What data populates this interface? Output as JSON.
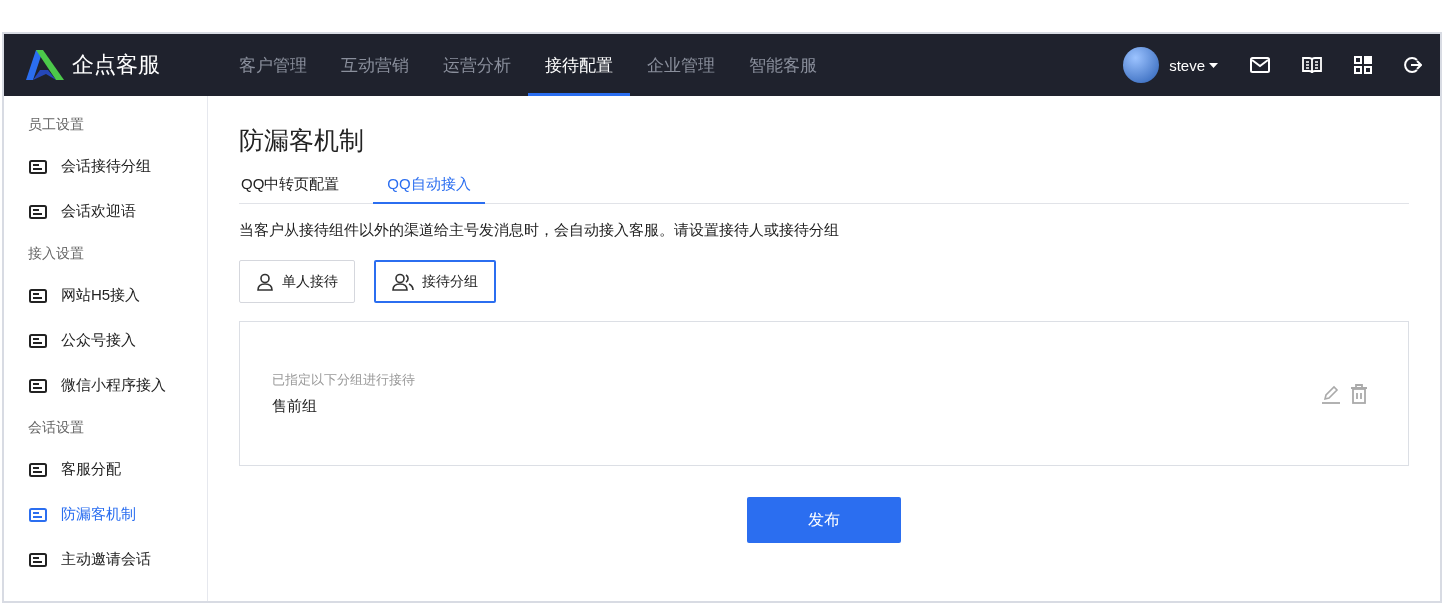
{
  "brand": {
    "name": "企点客服"
  },
  "nav": {
    "items": [
      {
        "label": "客户管理",
        "selected": false
      },
      {
        "label": "互动营销",
        "selected": false
      },
      {
        "label": "运营分析",
        "selected": false
      },
      {
        "label": "接待配置",
        "selected": true
      },
      {
        "label": "企业管理",
        "selected": false
      },
      {
        "label": "智能客服",
        "selected": false
      }
    ],
    "user": {
      "name": "steve"
    }
  },
  "sidebar": {
    "sections": [
      {
        "title": "员工设置",
        "items": [
          {
            "label": "会话接待分组",
            "selected": false
          },
          {
            "label": "会话欢迎语",
            "selected": false
          }
        ]
      },
      {
        "title": "接入设置",
        "items": [
          {
            "label": "网站H5接入",
            "selected": false
          },
          {
            "label": "公众号接入",
            "selected": false
          },
          {
            "label": "微信小程序接入",
            "selected": false
          }
        ]
      },
      {
        "title": "会话设置",
        "items": [
          {
            "label": "客服分配",
            "selected": false
          },
          {
            "label": "防漏客机制",
            "selected": true
          },
          {
            "label": "主动邀请会话",
            "selected": false
          }
        ]
      }
    ]
  },
  "page": {
    "title": "防漏客机制",
    "tabs": [
      {
        "label": "QQ中转页配置",
        "selected": false
      },
      {
        "label": "QQ自动接入",
        "selected": true
      }
    ],
    "description": "当客户从接待组件以外的渠道给主号发消息时，会自动接入客服。请设置接待人或接待分组",
    "modes": [
      {
        "label": "单人接待",
        "selected": false
      },
      {
        "label": "接待分组",
        "selected": true
      }
    ],
    "assignment": {
      "hint": "已指定以下分组进行接待",
      "group": "售前组"
    },
    "publish_button": "发布"
  }
}
